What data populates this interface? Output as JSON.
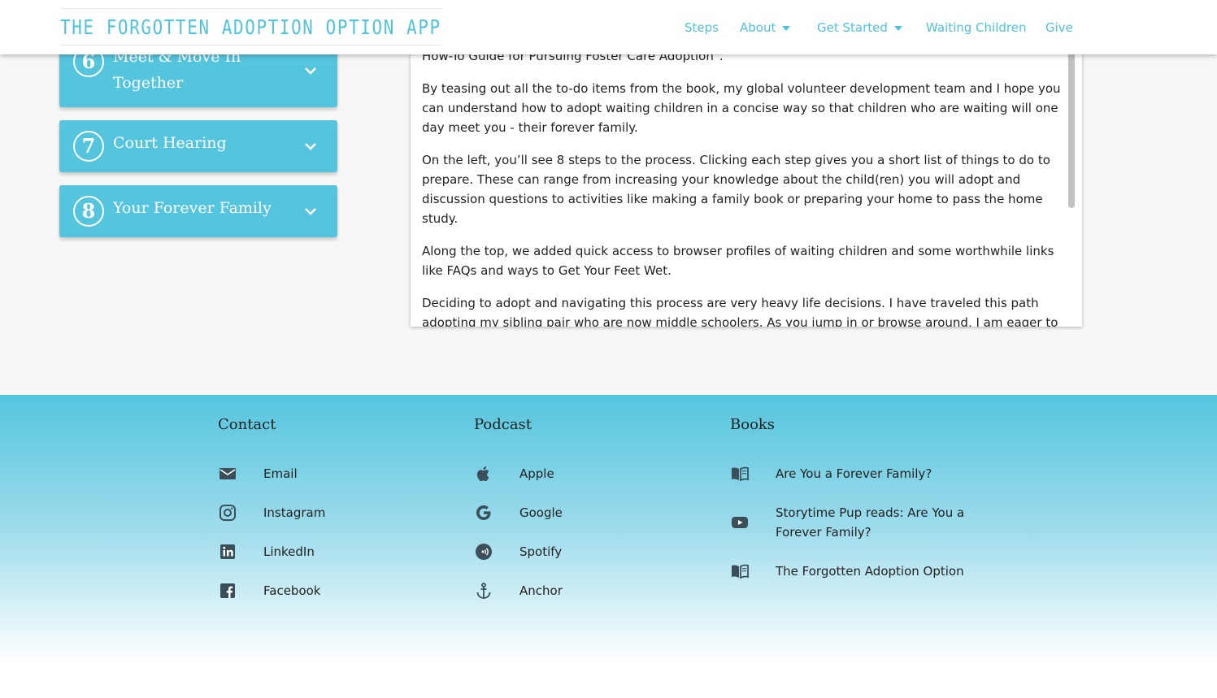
{
  "header": {
    "brand": "THE FORGOTTEN ADOPTION OPTION APP",
    "nav": {
      "steps": "Steps",
      "about": "About",
      "get_started": "Get Started",
      "waiting_children": "Waiting Children",
      "give": "Give"
    }
  },
  "steps": [
    {
      "number": "6",
      "label_line1": "Meet & Move In",
      "label_line2": "Together"
    },
    {
      "number": "7",
      "label": "Court Hearing"
    },
    {
      "number": "8",
      "label": "Your Forever Family"
    }
  ],
  "content": {
    "p0": "How-To Guide for Pursuing Foster Care Adoption\".",
    "p1": "By teasing out all the to-do items from the book, my global volunteer development team and I hope you can understand how to adopt waiting children in a concise way so that children who are waiting will one day meet you - their forever family.",
    "p2": "On the left, you’ll see 8 steps to the process. Clicking each step gives you a short list of things to do to prepare. These can range from increasing your knowledge about the child(ren) you will adopt and discussion questions to activities like making a family book or preparing your home to pass the home study.",
    "p3": "Along the top, we added quick access to browser profiles of waiting children and some worthwhile links like FAQs and ways to Get Your Feet Wet.",
    "p4": "Deciding to adopt and navigating this process are very heavy life decisions. I have traveled this path adopting my sibling pair who are now middle schoolers. As you jump in or browse around, I am eager to be"
  },
  "footer": {
    "contact": {
      "title": "Contact",
      "email": "Email",
      "instagram": "Instagram",
      "linkedin": "LinkedIn",
      "facebook": "Facebook"
    },
    "podcast": {
      "title": "Podcast",
      "apple": "Apple",
      "google": "Google",
      "spotify": "Spotify",
      "anchor": "Anchor"
    },
    "books": {
      "title": "Books",
      "book1": "Are You a Forever Family?",
      "video_line1": "Storytime Pup reads: Are You a",
      "video_line2": "Forever Family?",
      "book2": "The Forgotten Adoption Option"
    }
  },
  "colors": {
    "accent": "#55c5de",
    "brand": "#4ec3dc",
    "icon": "#3a4f5a"
  }
}
